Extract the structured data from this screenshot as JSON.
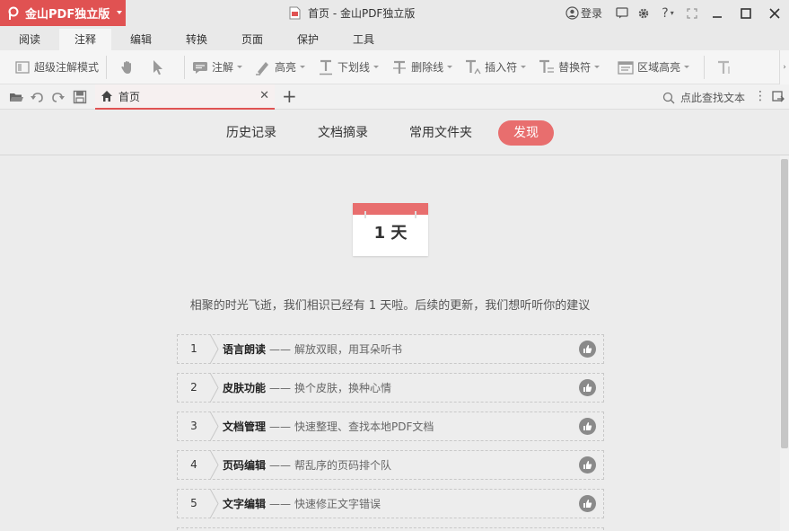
{
  "app": {
    "brand_name": "金山PDF独立版",
    "window_title": "首页 - 金山PDF独立版",
    "login_label": "登录",
    "help_label": "?"
  },
  "menu_tabs": [
    {
      "label": "阅读"
    },
    {
      "label": "注释",
      "active": true
    },
    {
      "label": "编辑"
    },
    {
      "label": "转换"
    },
    {
      "label": "页面"
    },
    {
      "label": "保护"
    },
    {
      "label": "工具"
    }
  ],
  "toolbar": {
    "super_annotation": "超级注解模式",
    "annotate": "注解",
    "highlight": "高亮",
    "underline": "下划线",
    "strikethrough": "删除线",
    "insert_mark": "插入符",
    "replace_mark": "替换符",
    "area_highlight": "区域高亮"
  },
  "doc_tab": {
    "label": "首页",
    "search_placeholder": "点此查找文本"
  },
  "nav": [
    {
      "label": "历史记录"
    },
    {
      "label": "文档摘录"
    },
    {
      "label": "常用文件夹"
    },
    {
      "label": "发现",
      "active": true
    }
  ],
  "calendar": {
    "days": "1 天"
  },
  "message": "相聚的时光飞逝，我们相识已经有 1 天啦。后续的更新，我们想听听你的建议",
  "features": [
    {
      "num": "1",
      "title": "语言朗读",
      "dash": "——",
      "desc": "解放双眼，用耳朵听书"
    },
    {
      "num": "2",
      "title": "皮肤功能",
      "dash": "——",
      "desc": "换个皮肤，换种心情"
    },
    {
      "num": "3",
      "title": "文档管理",
      "dash": "——",
      "desc": "快速整理、查找本地PDF文档"
    },
    {
      "num": "4",
      "title": "页码编辑",
      "dash": "——",
      "desc": "帮乱序的页码排个队"
    },
    {
      "num": "5",
      "title": "文字编辑",
      "dash": "——",
      "desc": "快速修正文字错误"
    }
  ],
  "colors": {
    "accent": "#e05252",
    "accent_light": "#e86e6e"
  }
}
